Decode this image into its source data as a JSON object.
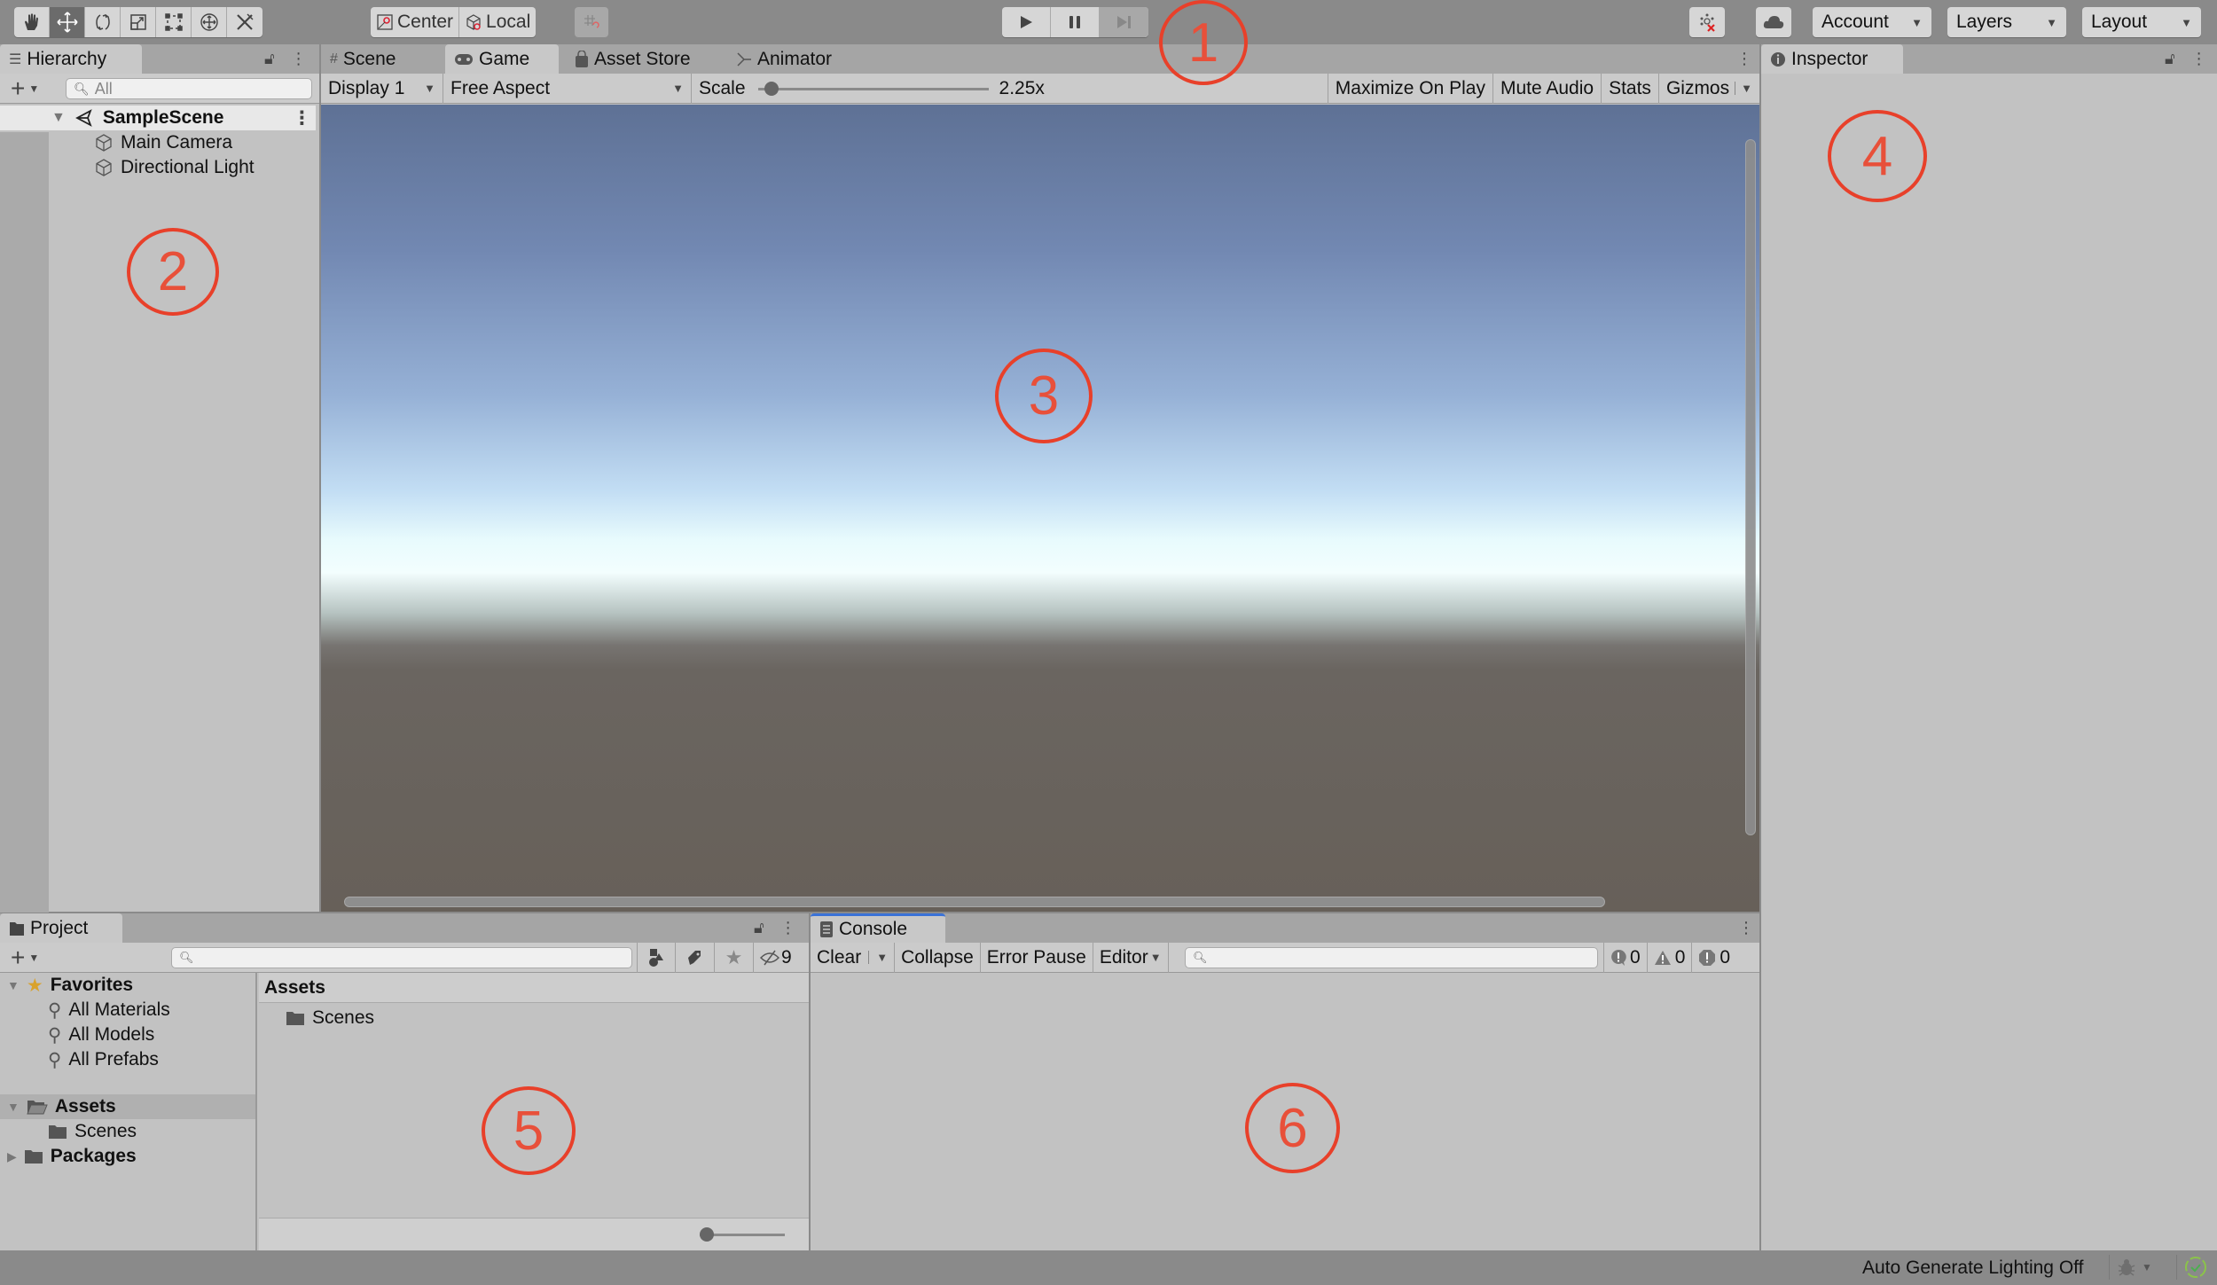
{
  "toolbar": {
    "tools": [
      {
        "name": "hand-tool",
        "icon": "hand-icon",
        "active": false
      },
      {
        "name": "move-tool",
        "icon": "move-icon",
        "active": true
      },
      {
        "name": "rotate-tool",
        "icon": "rotate-icon",
        "active": false
      },
      {
        "name": "scale-tool",
        "icon": "scale-icon",
        "active": false
      },
      {
        "name": "rect-tool",
        "icon": "rect-icon",
        "active": false
      },
      {
        "name": "transform-tool",
        "icon": "transform-icon",
        "active": false
      },
      {
        "name": "custom-tool",
        "icon": "tools-icon",
        "active": false
      }
    ],
    "pivot_mode": "Center",
    "pivot_rotation": "Local",
    "play_controls": [
      "play",
      "pause",
      "step"
    ],
    "account_label": "Account",
    "layers_label": "Layers",
    "layout_label": "Layout"
  },
  "hierarchy": {
    "tab_label": "Hierarchy",
    "search_placeholder": "All",
    "scene": "SampleScene",
    "objects": [
      "Main Camera",
      "Directional Light"
    ]
  },
  "center_tabs": [
    {
      "label": "Scene",
      "icon": "hash-icon"
    },
    {
      "label": "Game",
      "icon": "gamepad-icon",
      "active": true
    },
    {
      "label": "Asset Store",
      "icon": "bag-icon"
    },
    {
      "label": "Animator",
      "icon": "animator-icon"
    }
  ],
  "game": {
    "display": "Display 1",
    "aspect": "Free Aspect",
    "scale_label": "Scale",
    "scale_value": "2.25x",
    "scale_fraction": 0.03,
    "maximize_on_play": "Maximize On Play",
    "mute_audio": "Mute Audio",
    "stats": "Stats",
    "gizmos": "Gizmos"
  },
  "inspector": {
    "tab_label": "Inspector"
  },
  "project": {
    "tab_label": "Project",
    "hidden_count": "9",
    "favorites": {
      "label": "Favorites",
      "items": [
        "All Materials",
        "All Models",
        "All Prefabs"
      ]
    },
    "assets": {
      "label": "Assets",
      "children": [
        "Scenes"
      ]
    },
    "packages": {
      "label": "Packages"
    },
    "breadcrumb": "Assets",
    "content": [
      "Scenes"
    ],
    "icon_size_fraction": 0.0
  },
  "console": {
    "tab_label": "Console",
    "clear": "Clear",
    "collapse": "Collapse",
    "error_pause": "Error Pause",
    "editor": "Editor",
    "info_count": "0",
    "warning_count": "0",
    "error_count": "0"
  },
  "status": {
    "lighting": "Auto Generate Lighting Off"
  },
  "annotations": [
    "1",
    "2",
    "3",
    "4",
    "5",
    "6"
  ],
  "colors": {
    "annotation": "#e8402a",
    "accent_tab": "#3a72d8"
  }
}
